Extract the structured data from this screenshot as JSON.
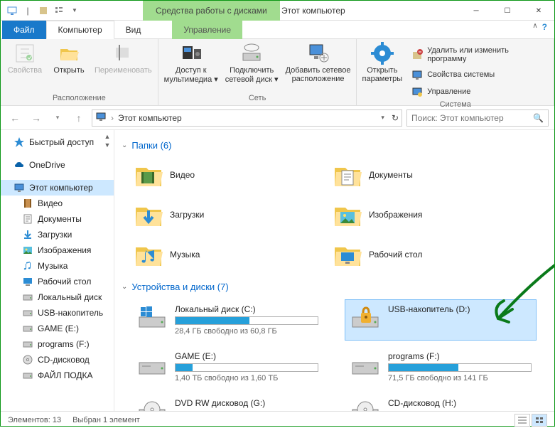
{
  "titlebar": {
    "tools_tab": "Средства работы с дисками",
    "title": "Этот компьютер"
  },
  "tabs": {
    "file": "Файл",
    "computer": "Компьютер",
    "view": "Вид",
    "manage": "Управление"
  },
  "ribbon": {
    "props": "Свойства",
    "open": "Открыть",
    "rename": "Переименовать",
    "group1": "Расположение",
    "media": "Доступ к\nмультимедиа ▾",
    "netdrive": "Подключить\nсетевой диск ▾",
    "addnet": "Добавить сетевое\nрасположение",
    "group2": "Сеть",
    "settings": "Открыть\nпараметры",
    "uninstall": "Удалить или изменить программу",
    "sysprops": "Свойства системы",
    "manage": "Управление",
    "group3": "Система"
  },
  "address": "Этот компьютер",
  "search_placeholder": "Поиск: Этот компьютер",
  "sidebar": [
    {
      "icon": "star",
      "label": "Быстрый доступ",
      "color": "#2c8cd4"
    },
    {
      "icon": "cloud",
      "label": "OneDrive",
      "color": "#0a62a9"
    },
    {
      "icon": "pc",
      "label": "Этот компьютер",
      "color": "#2c8cd4",
      "selected": true
    },
    {
      "icon": "film",
      "label": "Видео",
      "color": "#9a5b1a"
    },
    {
      "icon": "doc",
      "label": "Документы",
      "color": "#2c8cd4"
    },
    {
      "icon": "down",
      "label": "Загрузки",
      "color": "#2c8cd4"
    },
    {
      "icon": "img",
      "label": "Изображения",
      "color": "#2c8cd4"
    },
    {
      "icon": "music",
      "label": "Музыка",
      "color": "#2c8cd4"
    },
    {
      "icon": "desk",
      "label": "Рабочий стол",
      "color": "#2c8cd4"
    },
    {
      "icon": "disk",
      "label": "Локальный диск",
      "color": "#888"
    },
    {
      "icon": "disk",
      "label": "USB-накопитель",
      "color": "#888"
    },
    {
      "icon": "disk",
      "label": "GAME (E:)",
      "color": "#888"
    },
    {
      "icon": "disk",
      "label": "programs (F:)",
      "color": "#888"
    },
    {
      "icon": "dvd",
      "label": "CD-дисковод",
      "color": "#888"
    },
    {
      "icon": "disk",
      "label": "ФАЙЛ ПОДКА",
      "color": "#888"
    }
  ],
  "sections": {
    "folders_title": "Папки (6)",
    "devices_title": "Устройства и диски (7)"
  },
  "folders": [
    {
      "label": "Видео",
      "icon": "film"
    },
    {
      "label": "Документы",
      "icon": "doc"
    },
    {
      "label": "Загрузки",
      "icon": "down"
    },
    {
      "label": "Изображения",
      "icon": "img"
    },
    {
      "label": "Музыка",
      "icon": "music"
    },
    {
      "label": "Рабочий стол",
      "icon": "desk"
    }
  ],
  "drives": [
    {
      "label": "Локальный диск (C:)",
      "fill": 52,
      "free": "28,4 ГБ свободно из 60,8 ГБ",
      "icon": "win"
    },
    {
      "label": "USB-накопитель (D:)",
      "free": "",
      "icon": "lock",
      "selected": true
    },
    {
      "label": "GAME (E:)",
      "fill": 12,
      "free": "1,40 ТБ свободно из 1,60 ТБ",
      "icon": "hdd"
    },
    {
      "label": "programs (F:)",
      "fill": 49,
      "free": "71,5 ГБ свободно из 141 ГБ",
      "icon": "hdd"
    },
    {
      "label": "DVD RW дисковод (G:)",
      "free": "",
      "icon": "dvd"
    },
    {
      "label": "CD-дисковод (H:)",
      "free": "",
      "icon": "cd"
    }
  ],
  "status": {
    "count": "Элементов: 13",
    "selected": "Выбран 1 элемент"
  }
}
